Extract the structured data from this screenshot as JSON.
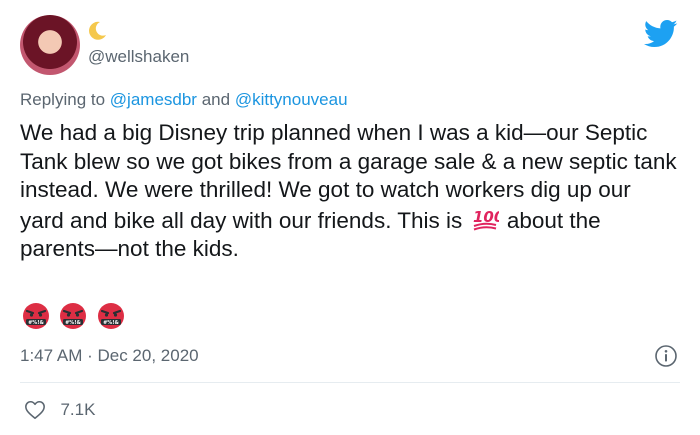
{
  "author": {
    "handle": "@wellshaken",
    "name_emoji_icon": "crescent-moon-icon"
  },
  "reply": {
    "prefix": "Replying to",
    "mention_1": "@jamesdbr",
    "joiner": "and",
    "mention_2": "@kittynouveau"
  },
  "tweet": {
    "text_before_emoji": "We had a big Disney trip planned when I was a kid—our Septic Tank blew so we got bikes from a garage sale & a new septic tank instead. We were thrilled! We got to watch workers dig up our yard and bike all day with our friends. This is",
    "inline_emoji_icon": "hundred-points-icon",
    "text_after_emoji": "about the parents—not the kids.",
    "emoji_row": [
      "angry-cursing-face-icon",
      "angry-cursing-face-icon",
      "angry-cursing-face-icon"
    ],
    "emoji_row_symbols": "#%!&"
  },
  "timestamp": "1:47 AM · Dec 20, 2020",
  "likes": "7.1K",
  "colors": {
    "accent": "#1da1f2",
    "mention": "#1b95e0",
    "muted": "#5b6670"
  }
}
